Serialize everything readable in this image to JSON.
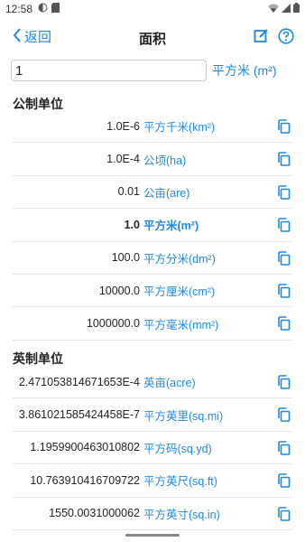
{
  "status": {
    "time": "12:58"
  },
  "nav": {
    "back_label": "返回",
    "title": "面积"
  },
  "input": {
    "value": "1",
    "unit": "平方米 (m²)"
  },
  "metric": {
    "title": "公制单位",
    "rows": [
      {
        "value": "1.0E-6",
        "unit": "平方千米(km²)"
      },
      {
        "value": "1.0E-4",
        "unit": "公顷(ha)"
      },
      {
        "value": "0.01",
        "unit": "公亩(are)"
      },
      {
        "value": "1.0",
        "unit": "平方米(m²)"
      },
      {
        "value": "100.0",
        "unit": "平方分米(dm²)"
      },
      {
        "value": "10000.0",
        "unit": "平方厘米(cm²)"
      },
      {
        "value": "1000000.0",
        "unit": "平方毫米(mm²)"
      }
    ]
  },
  "imperial": {
    "title": "英制单位",
    "rows": [
      {
        "value": "2.471053814671653E-4",
        "unit": "英亩(acre)"
      },
      {
        "value": "3.861021585424458E-7",
        "unit": "平方英里(sq.mi)"
      },
      {
        "value": "1.1959900463010802",
        "unit": "平方码(sq.yd)"
      },
      {
        "value": "10.763910416709722",
        "unit": "平方英尺(sq.ft)"
      },
      {
        "value": "1550.0031000062",
        "unit": "平方英寸(sq.in)"
      }
    ]
  },
  "colors": {
    "accent": "#1e88e5",
    "divider": "#e6e6e6"
  }
}
